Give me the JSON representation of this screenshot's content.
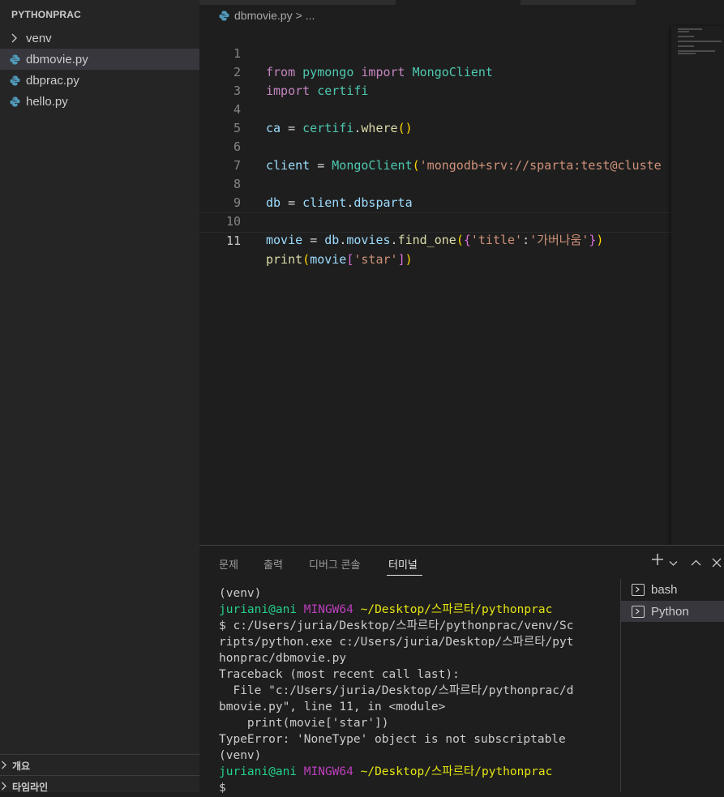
{
  "explorer": {
    "folder": "PYTHONPRAC",
    "items": [
      {
        "label": "venv",
        "type": "folder"
      },
      {
        "label": "dbmovie.py",
        "type": "python"
      },
      {
        "label": "dbprac.py",
        "type": "python"
      },
      {
        "label": "hello.py",
        "type": "python"
      }
    ],
    "outline": "개요",
    "timeline": "타임라인"
  },
  "breadcrumb": {
    "file": "dbmovie.py",
    "sep": ">",
    "more": "..."
  },
  "editor": {
    "line_numbers": [
      "1",
      "2",
      "3",
      "4",
      "5",
      "6",
      "7",
      "8",
      "9",
      "10",
      "11"
    ],
    "lines": [
      "from pymongo import MongoClient",
      "import certifi",
      "",
      "ca = certifi.where()",
      "",
      "client = MongoClient('mongodb+srv://sparta:test@cluste",
      "",
      "db = client.dbsparta",
      "",
      "movie = db.movies.find_one({'title':'가버나움'})",
      "print(movie['star'])"
    ]
  },
  "panel": {
    "tabs": [
      "문제",
      "출력",
      "디버그 콘솔",
      "터미널"
    ],
    "active_tab": "터미널",
    "actions": {
      "add": "+",
      "dropdown": "⌄",
      "maximize": "^",
      "close": "×"
    }
  },
  "terminal": {
    "venv1": "(venv)",
    "prompt1_user": "juriani@ani",
    "prompt1_env": "MINGW64",
    "prompt1_path": "~/Desktop/스파르타/pythonprac",
    "cmd_line1": "$ c:/Users/juria/Desktop/스파르타/pythonprac/venv/Sc",
    "cmd_line2": "ripts/python.exe c:/Users/juria/Desktop/스파르타/pyt",
    "cmd_line3": "honprac/dbmovie.py",
    "tb1": "Traceback (most recent call last):",
    "tb2": "  File \"c:/Users/juria/Desktop/스파르타/pythonprac/d",
    "tb3": "bmovie.py\", line 11, in <module>",
    "tb4": "    print(movie['star'])",
    "tb5": "TypeError: 'NoneType' object is not subscriptable",
    "venv2": "(venv)",
    "prompt2_user": "juriani@ani",
    "prompt2_env": "MINGW64",
    "prompt2_path": "~/Desktop/스파르타/pythonprac",
    "prompt2_dollar": "$"
  },
  "terminal_list": [
    "bash",
    "Python"
  ],
  "terminal_list_selected": "Python",
  "colors": {
    "python_icon": "#519aba",
    "green": "#23d18b",
    "purple": "#bc3fbc",
    "yellow": "#e5e510"
  }
}
